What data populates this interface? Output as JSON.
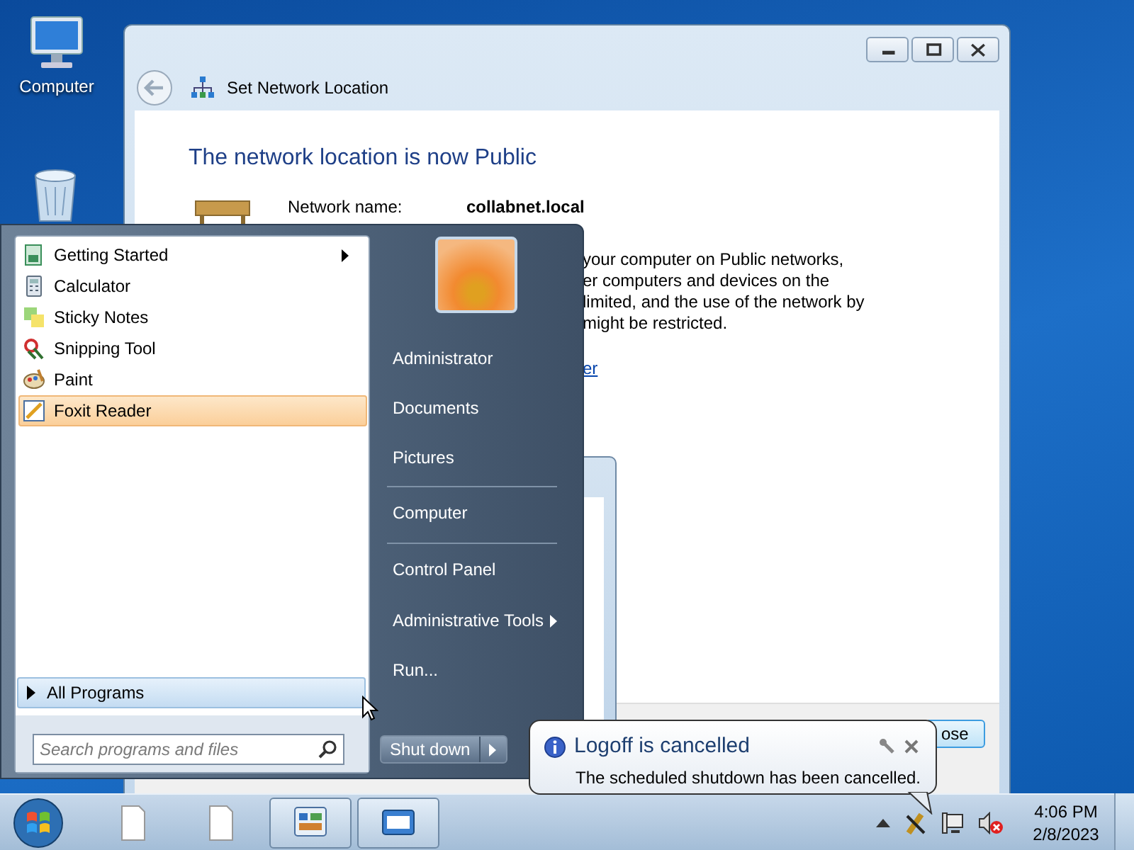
{
  "desktop_icons": [
    {
      "label": "Computer"
    }
  ],
  "window": {
    "title": "Set Network Location",
    "heading": "The network location is now Public",
    "network_name_label": "Network name:",
    "network_name": "collabnet.local",
    "description_lines": [
      "your computer on Public networks,",
      "er computers and devices on the",
      "limited, and the use of the network by",
      "might be restricted."
    ],
    "link": "er",
    "button": "ose"
  },
  "start_menu": {
    "programs": [
      {
        "label": "Getting Started",
        "has_submenu": true,
        "selected": false
      },
      {
        "label": "Calculator",
        "has_submenu": false,
        "selected": false
      },
      {
        "label": "Sticky Notes",
        "has_submenu": false,
        "selected": false
      },
      {
        "label": "Snipping Tool",
        "has_submenu": false,
        "selected": false
      },
      {
        "label": "Paint",
        "has_submenu": false,
        "selected": false
      },
      {
        "label": "Foxit Reader",
        "has_submenu": false,
        "selected": true
      }
    ],
    "all_programs": "All Programs",
    "search": {
      "placeholder": "Search programs and files"
    },
    "places": [
      {
        "label": "Administrator",
        "has_submenu": false,
        "separator_before": false
      },
      {
        "label": "Documents",
        "has_submenu": false,
        "separator_before": false
      },
      {
        "label": "Pictures",
        "has_submenu": false,
        "separator_before": false
      },
      {
        "label": "Computer",
        "has_submenu": false,
        "separator_before": true
      },
      {
        "label": "Control Panel",
        "has_submenu": false,
        "separator_before": true
      },
      {
        "label": "Administrative Tools",
        "has_submenu": true,
        "separator_before": false
      },
      {
        "label": "Run...",
        "has_submenu": false,
        "separator_before": false
      }
    ],
    "shutdown": "Shut down"
  },
  "balloon": {
    "title": "Logoff is cancelled",
    "message": "The scheduled shutdown has been cancelled."
  },
  "taskbar": {
    "buttons": [
      {
        "running": false
      },
      {
        "running": false
      },
      {
        "running": true
      },
      {
        "running": true
      }
    ],
    "clock": {
      "time": "4:06 PM",
      "date": "2/8/2023"
    }
  }
}
